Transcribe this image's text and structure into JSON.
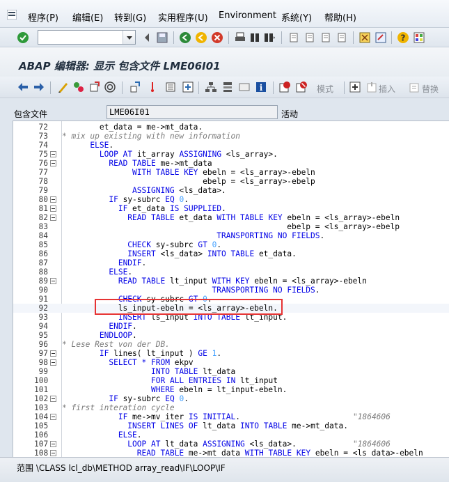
{
  "menu": {
    "items": [
      "程序(P)",
      "编辑(E)",
      "转到(G)",
      "实用程序(U)",
      "Environment",
      "系统(Y)",
      "帮助(H)"
    ]
  },
  "toolbar": {
    "command_field_value": "",
    "icons": [
      "enter-icon",
      "save-icon",
      "back-icon",
      "exit-icon",
      "cancel-icon",
      "print-icon",
      "find-icon",
      "find-next-icon",
      "first-page-icon",
      "prev-page-icon",
      "next-page-icon",
      "last-page-icon",
      "new-session-icon",
      "shortcut-icon",
      "help-icon",
      "layout-icon"
    ]
  },
  "title": "ABAP 编辑器: 显示 包含文件 LME06I01",
  "app_toolbar": {
    "pattern_label": "模式",
    "insert_label": "插入",
    "replace_label": "替换"
  },
  "include": {
    "label": "包含文件",
    "value": "LME06I01",
    "status": "活动"
  },
  "code_lines": [
    {
      "n": "72",
      "fold": false,
      "t": "        et_data = me->mt_data."
    },
    {
      "n": "73",
      "fold": false,
      "t": "* mix up existing with new information"
    },
    {
      "n": "74",
      "fold": false,
      "t": "      ELSE."
    },
    {
      "n": "75",
      "fold": true,
      "t": "        LOOP AT it_array ASSIGNING <ls_array>."
    },
    {
      "n": "76",
      "fold": true,
      "t": "          READ TABLE me->mt_data"
    },
    {
      "n": "77",
      "fold": false,
      "t": "               WITH TABLE KEY ebeln = <ls_array>-ebeln"
    },
    {
      "n": "78",
      "fold": false,
      "t": "                              ebelp = <ls_array>-ebelp"
    },
    {
      "n": "79",
      "fold": false,
      "t": "               ASSIGNING <ls_data>."
    },
    {
      "n": "80",
      "fold": true,
      "t": "          IF sy-subrc EQ 0."
    },
    {
      "n": "81",
      "fold": true,
      "t": "            IF et_data IS SUPPLIED."
    },
    {
      "n": "82",
      "fold": true,
      "t": "              READ TABLE et_data WITH TABLE KEY ebeln = <ls_array>-ebeln"
    },
    {
      "n": "83",
      "fold": false,
      "t": "                                                ebelp = <ls_array>-ebelp"
    },
    {
      "n": "84",
      "fold": false,
      "t": "                                 TRANSPORTING NO FIELDS."
    },
    {
      "n": "85",
      "fold": false,
      "t": "              CHECK sy-subrc GT 0."
    },
    {
      "n": "86",
      "fold": false,
      "t": "              INSERT <ls_data> INTO TABLE et_data."
    },
    {
      "n": "87",
      "fold": false,
      "t": "            ENDIF."
    },
    {
      "n": "88",
      "fold": false,
      "t": "          ELSE."
    },
    {
      "n": "89",
      "fold": true,
      "t": "            READ TABLE lt_input WITH KEY ebeln = <ls_array>-ebeln"
    },
    {
      "n": "90",
      "fold": false,
      "t": "                                TRANSPORTING NO FIELDS."
    },
    {
      "n": "91",
      "fold": false,
      "t": "            CHECK sy-subrc GT 0."
    },
    {
      "n": "92",
      "fold": false,
      "t": "            ls_input-ebeln = <ls_array>-ebeln."
    },
    {
      "n": "93",
      "fold": false,
      "t": "            INSERT ls_input INTO TABLE lt_input."
    },
    {
      "n": "94",
      "fold": false,
      "t": "          ENDIF."
    },
    {
      "n": "95",
      "fold": false,
      "t": "        ENDLOOP."
    },
    {
      "n": "96",
      "fold": false,
      "t": "* Lese Rest von der DB."
    },
    {
      "n": "97",
      "fold": true,
      "t": "        IF lines( lt_input ) GE 1."
    },
    {
      "n": "98",
      "fold": true,
      "t": "          SELECT * FROM ekpv"
    },
    {
      "n": "99",
      "fold": false,
      "t": "                   INTO TABLE lt_data"
    },
    {
      "n": "100",
      "fold": false,
      "t": "                   FOR ALL ENTRIES IN lt_input"
    },
    {
      "n": "101",
      "fold": false,
      "t": "                   WHERE ebeln = lt_input-ebeln."
    },
    {
      "n": "102",
      "fold": true,
      "t": "          IF sy-subrc EQ 0."
    },
    {
      "n": "103",
      "fold": false,
      "t": "* first interation cycle"
    },
    {
      "n": "104",
      "fold": true,
      "t": "            IF me->mv_iter IS INITIAL.",
      "r": "\"1864606"
    },
    {
      "n": "105",
      "fold": false,
      "t": "              INSERT LINES OF lt_data INTO TABLE me->mt_data."
    },
    {
      "n": "106",
      "fold": false,
      "t": "            ELSE."
    },
    {
      "n": "107",
      "fold": true,
      "t": "              LOOP AT lt_data ASSIGNING <ls_data>.",
      "r": "\"1864606"
    },
    {
      "n": "108",
      "fold": true,
      "t": "                READ TABLE me->mt_data WITH TABLE KEY ebeln = <ls_data>-ebeln"
    }
  ],
  "scope": "范围 \\CLASS lcl_db\\METHOD array_read\\IF\\LOOP\\IF",
  "colors": {
    "keyword": "#0000e6",
    "comment": "#7a7a7a",
    "number": "#3f9fff",
    "highlight_box": "#e63333"
  }
}
